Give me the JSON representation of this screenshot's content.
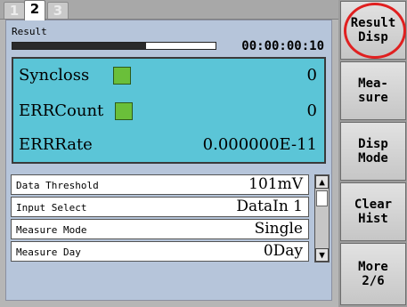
{
  "tabs": [
    {
      "label": "1",
      "active": false
    },
    {
      "label": "2",
      "active": true
    },
    {
      "label": "3",
      "active": false
    }
  ],
  "result": {
    "title": "Result",
    "progress_fraction": 0.66,
    "elapsed": "00:00:00:10"
  },
  "measurements": {
    "syncloss": {
      "label": "Syncloss",
      "value": "0",
      "indicator_color": "#6abf3a"
    },
    "errcount": {
      "label": "ERRCount",
      "value": "0",
      "indicator_color": "#6abf3a"
    },
    "errrate": {
      "label": "ERRRate",
      "value": "0.000000E-11"
    }
  },
  "settings": [
    {
      "label": "Data Threshold",
      "value": "101mV"
    },
    {
      "label": "Input Select",
      "value": "DataIn 1"
    },
    {
      "label": "Measure Mode",
      "value": "Single"
    },
    {
      "label": "Measure Day",
      "value": "0Day"
    }
  ],
  "scrollbar": {
    "up_glyph": "▲",
    "down_glyph": "▼"
  },
  "softkeys": [
    {
      "label": "Result\nDisp",
      "highlighted": true
    },
    {
      "label": "Mea-\nsure"
    },
    {
      "label": "Disp\nMode"
    },
    {
      "label": "Clear\nHist"
    },
    {
      "label": "More\n2/6"
    }
  ],
  "colors": {
    "panel_bg": "#b6c5da",
    "result_box_bg": "#5bc5d7",
    "highlight_ring": "#e02020"
  }
}
